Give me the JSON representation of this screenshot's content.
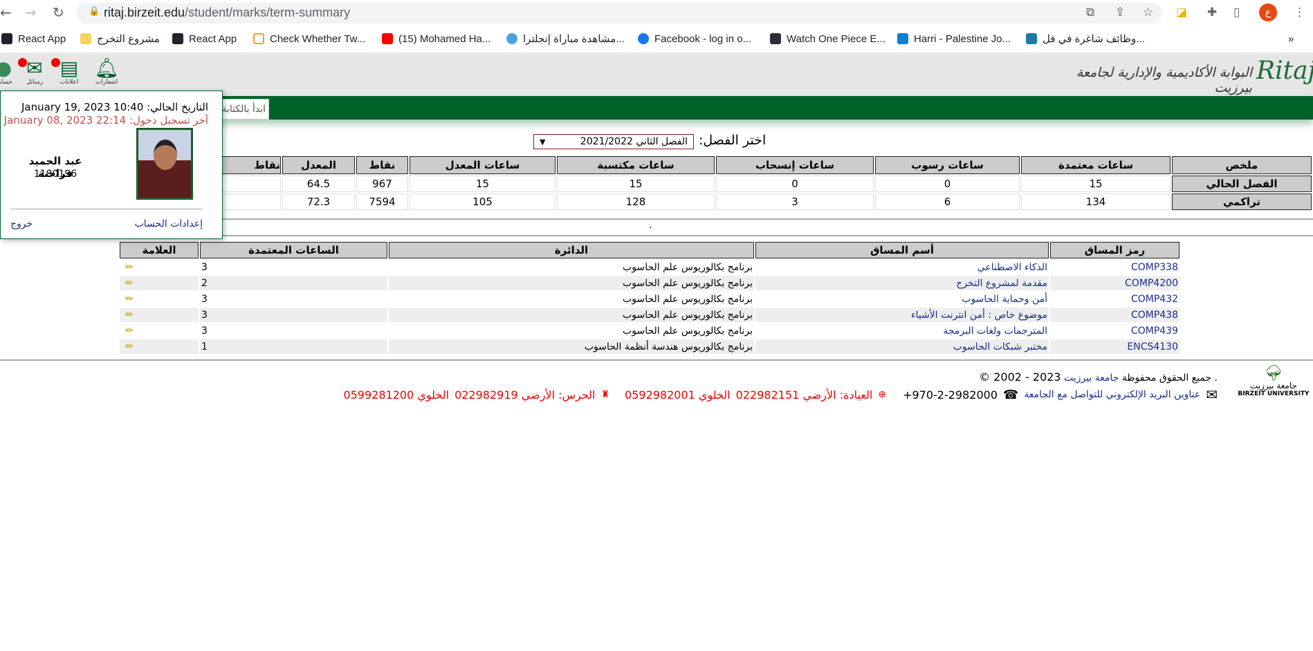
{
  "browser": {
    "url_domain": "ritaj.birzeit.edu",
    "url_path": "/student/marks/term-summary",
    "profile_initial": "ع",
    "bookmarks": [
      "React App",
      "مشروع التخرج",
      "React App",
      "Check Whether Tw...",
      "(15) Mohamed Ha...",
      "مشاهدة مباراة إنجلترا...",
      "Facebook - log in o...",
      "Watch One Piece E...",
      "Harri - Palestine Jo...",
      "وظائف شاغرة في فل..."
    ],
    "more": "»"
  },
  "header": {
    "site_title": "البوابة الأكاديمية والإدارية لجامعة بيرزيت",
    "logo_text": "Ritaj",
    "search_placeholder": "ابدأ بالكتابة",
    "icons": [
      {
        "label": "اشعارات",
        "icon": "bell-icon",
        "badge": false
      },
      {
        "label": "اعلانات",
        "icon": "newspaper-icon",
        "badge": true
      },
      {
        "label": "رسائل",
        "icon": "envelope-icon",
        "badge": true
      },
      {
        "label": "حسابي",
        "icon": "user-icon",
        "badge": false
      }
    ]
  },
  "popup": {
    "current_date": "التاريخ الحالي: January 19, 2023 10:40",
    "last_login": "آخر تسجيل دخول: January 08, 2023 22:14",
    "name": "عبد الحميد فراحنة",
    "student_id": "1180196",
    "account_settings": "إعدادات الحساب",
    "logout": "خروج"
  },
  "semester": {
    "label": "اختر الفصل:",
    "selected": "الفصل الثاني 2021/2022"
  },
  "summary": {
    "headers": [
      "ملخص",
      "ساعات معتمدة",
      "ساعات رسوب",
      "ساعات إنسحاب",
      "ساعات مكتسبة",
      "ساعات المعدل",
      "نقاط",
      "المعدل",
      "نقاط"
    ],
    "rows": [
      {
        "label": "الفصل الحالي",
        "values": [
          "15",
          "0",
          "0",
          "15",
          "15",
          "967",
          "64.5",
          ""
        ]
      },
      {
        "label": "تراكمي",
        "values": [
          "134",
          "6",
          "3",
          "128",
          "105",
          "7594",
          "72.3",
          ""
        ]
      }
    ],
    "note": "."
  },
  "courses": {
    "headers": [
      "رمز المساق",
      "أسم المساق",
      "الدائرة",
      "الساعات المعتمدة",
      "العلامة"
    ],
    "rows": [
      {
        "code": "COMP338",
        "name": "الذكاء الاصطناعي",
        "dept": "برنامج بكالوريوس علم الحاسوب",
        "hours": "3"
      },
      {
        "code": "COMP4200",
        "name": "مقدمة لمشروع التخرج",
        "dept": "برنامج بكالوريوس علم الحاسوب",
        "hours": "2"
      },
      {
        "code": "COMP432",
        "name": "أمن وحماية الحاسوب",
        "dept": "برنامج بكالوريوس علم الحاسوب",
        "hours": "3"
      },
      {
        "code": "COMP438",
        "name": "موضوع خاص : أمن انترنت الأشياء",
        "dept": "برنامج بكالوريوس علم الحاسوب",
        "hours": "3"
      },
      {
        "code": "COMP439",
        "name": "المترجمات ولغات البرمجة",
        "dept": "برنامج بكالوريوس علم الحاسوب",
        "hours": "3"
      },
      {
        "code": "ENCS4130",
        "name": "مختبر شبكات الحاسوب",
        "dept": "برنامج بكالوريوس هندسة أنظمة الحاسوب",
        "hours": "1"
      }
    ]
  },
  "footer": {
    "copyright_prefix": "© 2002 - 2023",
    "university_link": "جامعة بيرزيت",
    "rights": ". جميع الحقوق محفوظة",
    "emails_link": "عناوين البريد الإلكتروني للتواصل مع الجامعة",
    "phone": "+970-2-2982000",
    "clinic": "العيادة: الأرضي 022982151",
    "clinic_mobile": "الخلوي 0592982001",
    "guard": "الحرس: الأرضي 022982919",
    "guard_mobile": "الخلوي 0599281200",
    "logo_text": "BIRZEIT UNIVERSITY",
    "logo_arabic": "جامعة بيرزيت"
  }
}
